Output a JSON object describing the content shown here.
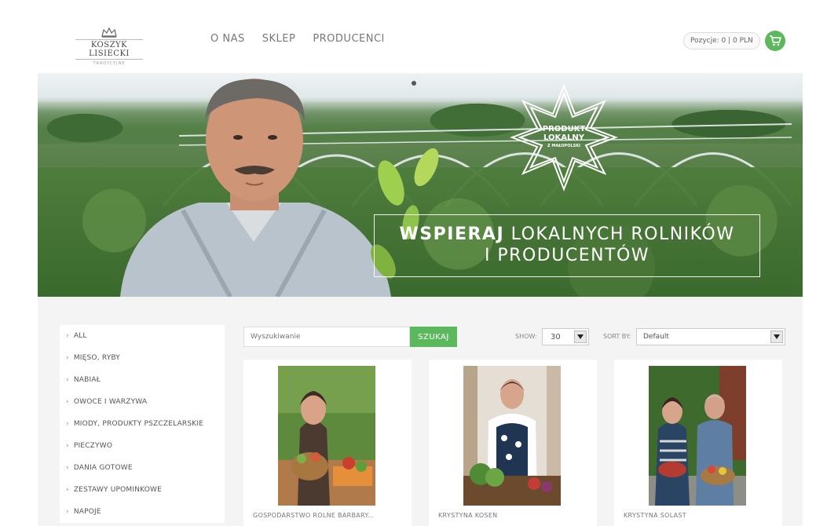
{
  "header": {
    "logo_main": "KOSZYK LISIECKI",
    "logo_sub": "TRADYCYJNE",
    "nav": [
      {
        "label": "O NAS"
      },
      {
        "label": "SKLEP"
      },
      {
        "label": "PRODUCENCI"
      }
    ],
    "cart_text": "Pozycje: 0 | 0 PLN",
    "accent_color": "#5cb85c"
  },
  "hero": {
    "badge_line1": "PRODUKT",
    "badge_line2": "LOKALNY",
    "badge_line3": "Z MAŁOPOLSKI",
    "slogan_bold": "WSPIERAJ",
    "slogan_rest": "LOKALNYCH ROLNIKÓW",
    "slogan_line2": "I PRODUCENTÓW"
  },
  "sidebar": {
    "categories": [
      {
        "label": "ALL"
      },
      {
        "label": "MIĘSO, RYBY"
      },
      {
        "label": "NABIAŁ"
      },
      {
        "label": "OWOCE I WARZYWA"
      },
      {
        "label": "MIODY, PRODUKTY PSZCZELARSKIE"
      },
      {
        "label": "PIECZYWO"
      },
      {
        "label": "DANIA GOTOWE"
      },
      {
        "label": "ZESTAWY UPOMINKOWE"
      },
      {
        "label": "NAPOJE"
      }
    ]
  },
  "search": {
    "placeholder": "Wyszukiwanie",
    "button_label": "SZUKAJ"
  },
  "filters": {
    "show_label": "SHOW:",
    "show_value": "30",
    "sort_label": "SORT BY:",
    "sort_value": "Default"
  },
  "products": [
    {
      "title": "GOSPODARSTWO ROLNE BARBARY..."
    },
    {
      "title": "KRYSTYNA KOSEŃ"
    },
    {
      "title": "KRYSTYNA SOLAST"
    }
  ]
}
